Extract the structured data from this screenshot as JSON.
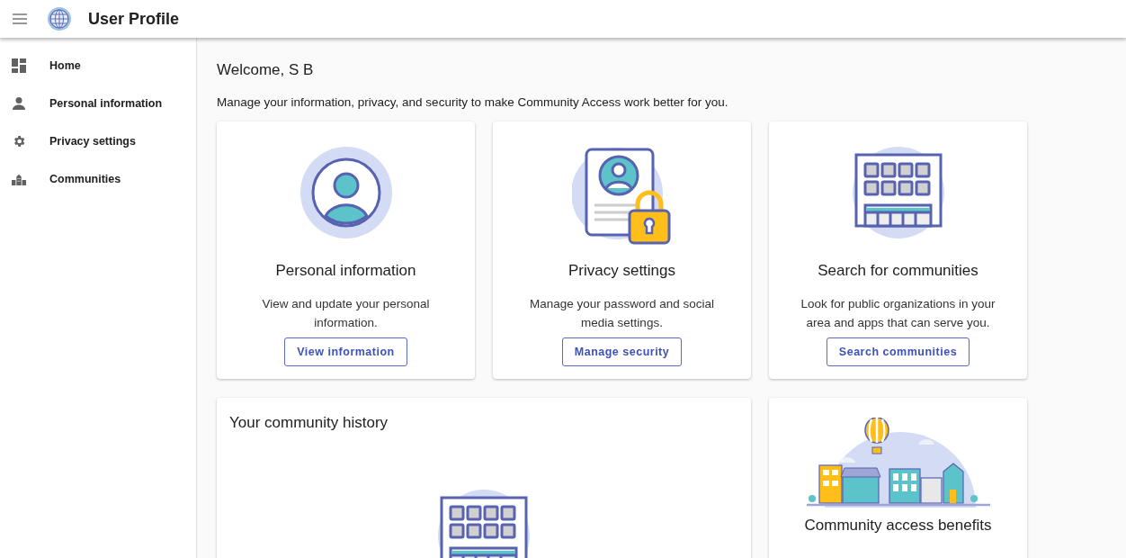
{
  "header": {
    "title": "User Profile"
  },
  "sidebar": {
    "items": [
      {
        "label": "Home"
      },
      {
        "label": "Personal information"
      },
      {
        "label": "Privacy settings"
      },
      {
        "label": "Communities"
      }
    ]
  },
  "welcome": {
    "title": "Welcome, S B",
    "subtitle": "Manage your information, privacy, and security to make Community Access work better for you."
  },
  "cards": [
    {
      "title": "Personal information",
      "description": "View and update your personal information.",
      "button": "View information"
    },
    {
      "title": "Privacy settings",
      "description": "Manage your password and social media settings.",
      "button": "Manage security"
    },
    {
      "title": "Search for communities",
      "description": "Look for public organizations in your area and apps that can serve you.",
      "button": "Search communities"
    }
  ],
  "history": {
    "title": "Your community history"
  },
  "benefits": {
    "title": "Community access benefits"
  }
}
